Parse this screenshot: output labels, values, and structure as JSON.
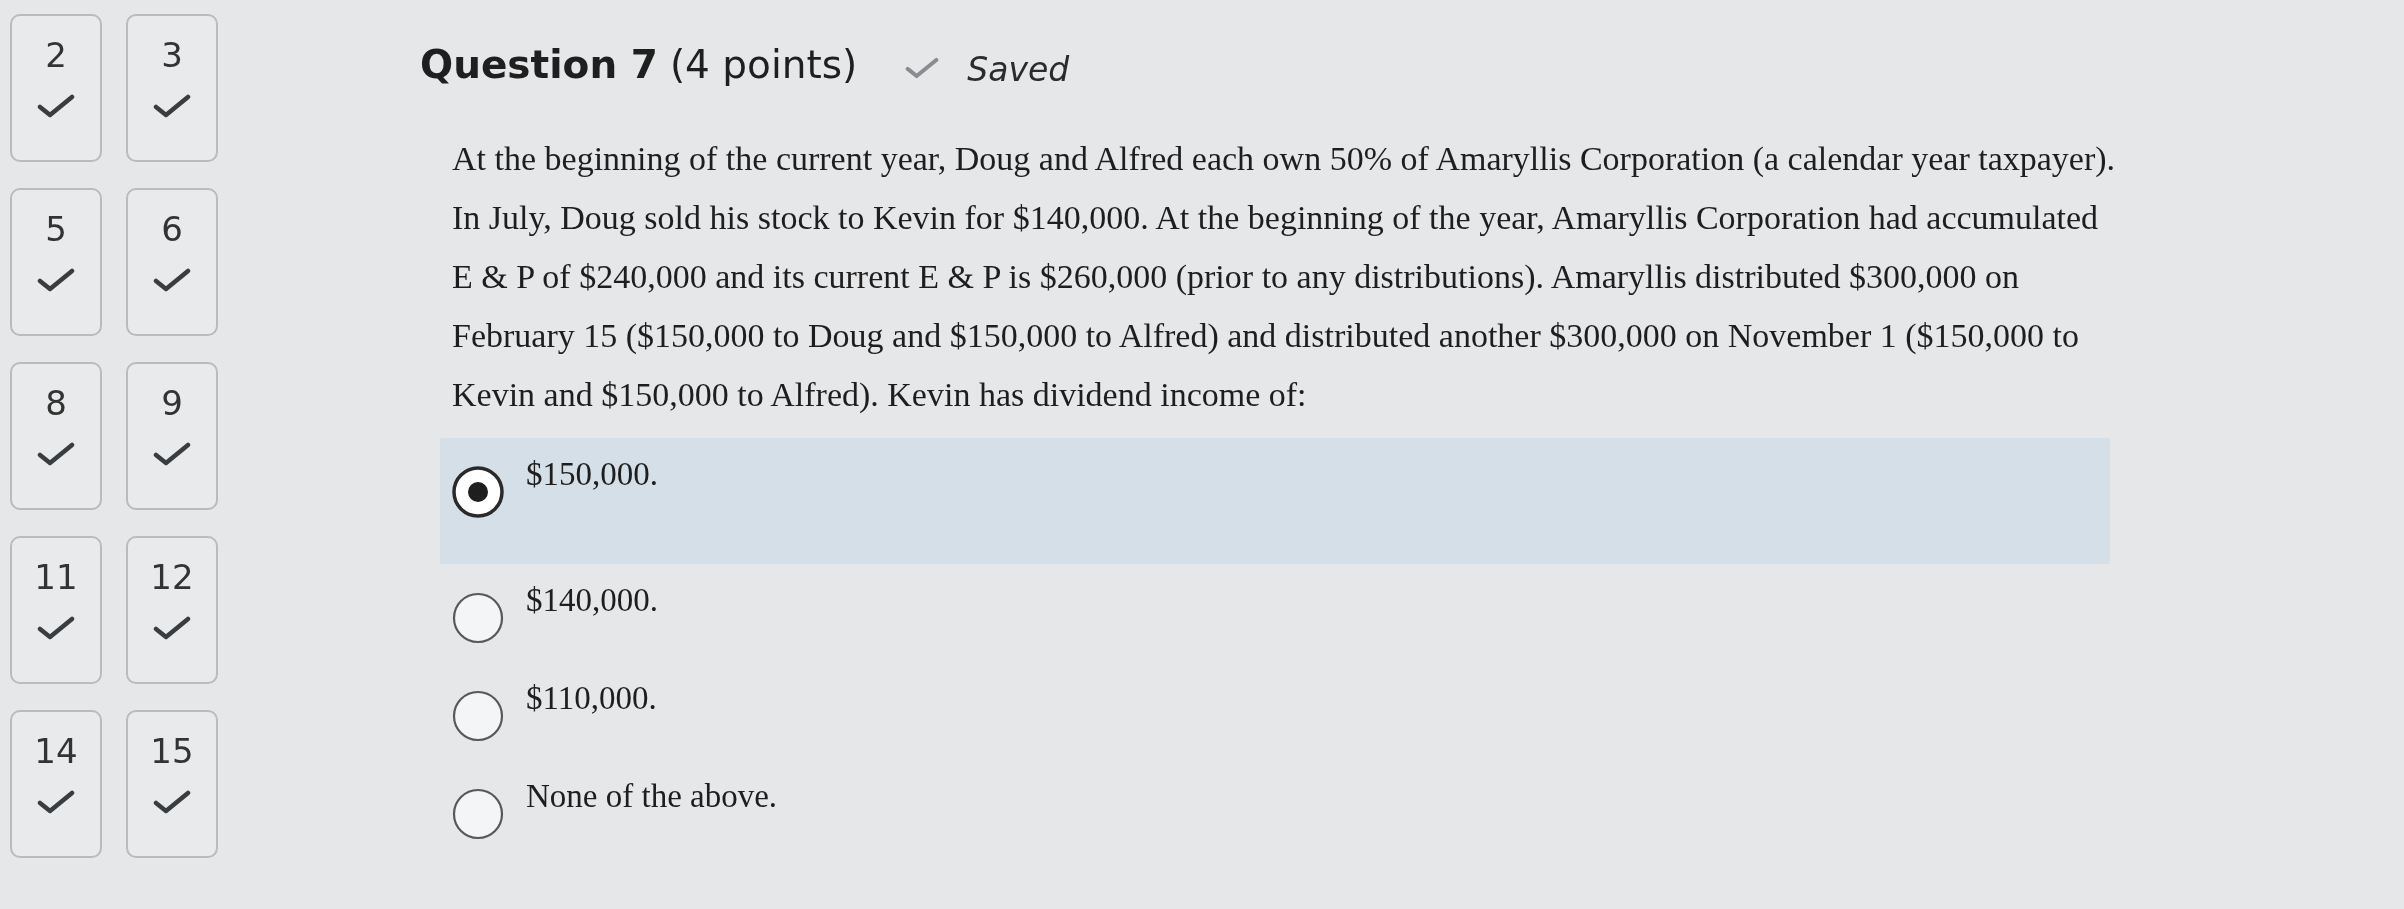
{
  "question_nav": [
    {
      "number": "2",
      "answered": true
    },
    {
      "number": "3",
      "answered": true
    },
    {
      "number": "5",
      "answered": true
    },
    {
      "number": "6",
      "answered": true
    },
    {
      "number": "8",
      "answered": true
    },
    {
      "number": "9",
      "answered": true
    },
    {
      "number": "11",
      "answered": true
    },
    {
      "number": "12",
      "answered": true
    },
    {
      "number": "14",
      "answered": true
    },
    {
      "number": "15",
      "answered": true
    }
  ],
  "question": {
    "title": "Question 7",
    "points": "(4 points)",
    "saved": true,
    "saved_label": "Saved",
    "text": "At the beginning of the current year, Doug and Alfred each own 50% of Amaryllis Corporation (a calendar year taxpayer). In July, Doug sold his stock to Kevin for $140,000. At the beginning of the year, Amaryllis Corporation had accumulated E & P of $240,000 and its current E & P is $260,000 (prior to any distributions). Amaryllis distributed $300,000 on February 15 ($150,000 to Doug and $150,000 to Alfred) and distributed another $300,000 on November 1 ($150,000 to Kevin and $150,000 to Alfred). Kevin has dividend income of:"
  },
  "options": [
    {
      "label": "$150,000.",
      "selected": true
    },
    {
      "label": "$140,000.",
      "selected": false
    },
    {
      "label": "$110,000.",
      "selected": false
    },
    {
      "label": "None of the above.",
      "selected": false
    }
  ]
}
